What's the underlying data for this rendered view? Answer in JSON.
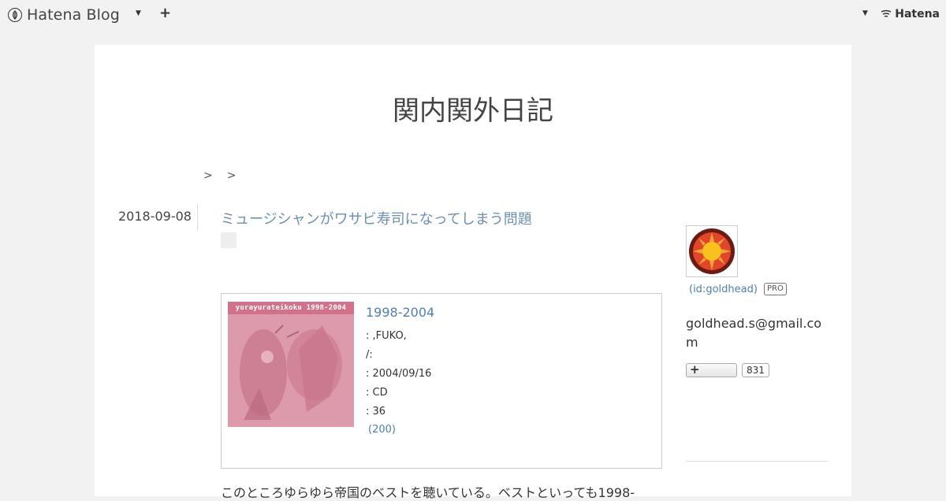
{
  "toolbar": {
    "brand": "Hatena Blog",
    "hatena": "Hatena"
  },
  "blog": {
    "title": "関内関外日記"
  },
  "breadcrumb": {
    "sep1": ">",
    "sep2": ">"
  },
  "entry": {
    "date": "2018-09-08",
    "title": "ミュージシャンがワサビ寿司になってしまう問題",
    "body": "このところゆらゆら帝国のベストを聴いている。ベストといっても1998-"
  },
  "product": {
    "cover_text": "yurayurateikoku 1998-2004",
    "title": "1998-2004",
    "artist_line": ":   ,FUKO,",
    "label_line": "/:",
    "date_line": ":   2004/09/16",
    "format_line": ":   CD",
    "count_line": ": 36",
    "link": "(200)"
  },
  "sidebar": {
    "user_id": "(id:goldhead)",
    "pro": "PRO",
    "email": "goldhead.s@gmail.com",
    "follow_count": "831"
  },
  "colors": {
    "link": "#4f7fb2",
    "title_link": "#6c8fb3",
    "background": "#f2f2f2"
  }
}
